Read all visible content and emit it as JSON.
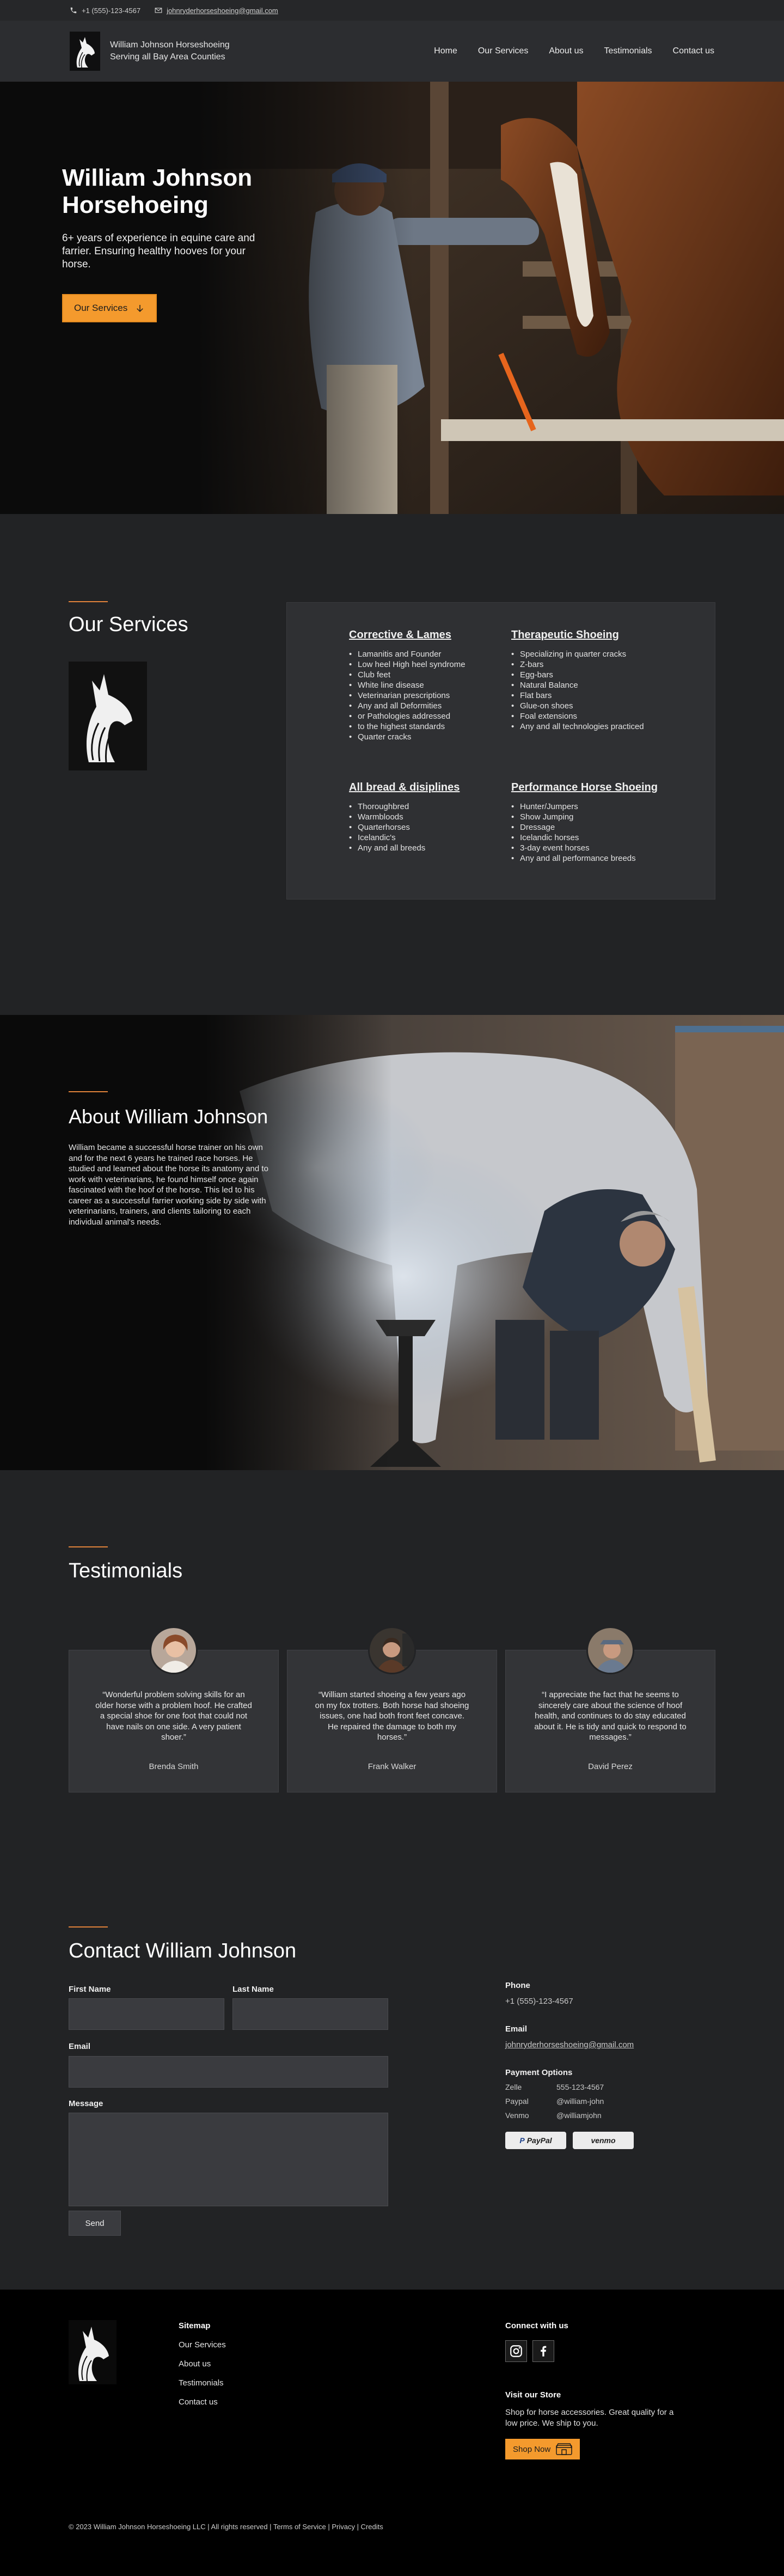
{
  "topbar": {
    "phone": "+1 (555)-123-4567",
    "email": "johnryderhorseshoeing@gmail.com"
  },
  "header": {
    "brand_line1": "William Johnson Horseshoeing",
    "brand_line2": "Serving all Bay Area Counties",
    "nav": [
      "Home",
      "Our Services",
      "About us",
      "Testimonials",
      "Contact us"
    ]
  },
  "hero": {
    "title": "William Johnson Horsehoeing",
    "subtitle": "6+ years of experience in equine care and farrier. Ensuring healthy hooves for your horse.",
    "cta": "Our Services"
  },
  "services": {
    "title": "Our Services",
    "columns": [
      {
        "heading": "Corrective & Lames",
        "items": [
          "Lamanitis and Founder",
          "Low heel High heel syndrome",
          "Club feet",
          "White line disease",
          "Veterinarian prescriptions",
          "Any and all Deformities",
          "or Pathologies addressed",
          "to the highest standards",
          "Quarter cracks"
        ]
      },
      {
        "heading": "Therapeutic Shoeing",
        "items": [
          "Specializing in quarter cracks",
          "Z-bars",
          "Egg-bars",
          "Natural Balance",
          "Flat bars",
          "Glue-on shoes",
          "Foal extensions",
          "Any and all technologies practiced"
        ]
      },
      {
        "heading": "All bread & disiplines",
        "items": [
          "Thoroughbred",
          "Warmbloods",
          "Quarterhorses",
          "Icelandic's",
          "Any and all breeds"
        ]
      },
      {
        "heading": "Performance Horse Shoeing",
        "items": [
          "Hunter/Jumpers",
          "Show Jumping",
          "Dressage",
          "Icelandic horses",
          "3-day event horses",
          "Any and all performance breeds"
        ]
      }
    ]
  },
  "about": {
    "title": "About William Johnson",
    "body": "William became a successful horse trainer on his own and for the next 6 years he trained race horses. He studied and learned about the horse its anatomy and to work with veterinarians, he found himself once again fascinated with the hoof of the horse. This led to his career as a successful farrier working side by side with veterinarians, trainers, and clients tailoring to each individual animal's needs."
  },
  "testimonials": {
    "title": "Testimonials",
    "items": [
      {
        "quote": "“Wonderful problem solving skills for an older horse with a problem hoof. He crafted a special shoe for one foot that could not have nails on one side. A very patient shoer.”",
        "name": "Brenda Smith"
      },
      {
        "quote": "“William started shoeing a few years ago on my fox trotters. Both horse had shoeing issues, one had both front feet concave. He repaired the damage to both my horses.”",
        "name": "Frank Walker"
      },
      {
        "quote": "“I appreciate the fact that he seems to sincerely care about the science of hoof health, and continues to do stay educated about it. He is tidy and quick to respond to messages.”",
        "name": "David Perez"
      }
    ]
  },
  "contact": {
    "title": "Contact William Johnson",
    "first_name": "First Name",
    "last_name": "Last Name",
    "email_label": "Email",
    "message_label": "Message",
    "send": "Send",
    "phone_label": "Phone",
    "phone": "+1 (555)-123-4567",
    "email_info_label": "Email",
    "email": "johnryderhorseshoeing@gmail.com",
    "payment_label": "Payment Options",
    "payments": [
      {
        "method": "Zelle",
        "handle": "555-123-4567"
      },
      {
        "method": "Paypal",
        "handle": "@william-john"
      },
      {
        "method": "Venmo",
        "handle": "@williamjohn"
      }
    ],
    "badge_paypal": "PayPal",
    "badge_venmo": "venmo"
  },
  "footer": {
    "sitemap_label": "Sitemap",
    "links": [
      "Our Services",
      "About us",
      "Testimonials",
      "Contact us"
    ],
    "connect_label": "Connect with us",
    "store_label": "Visit our Store",
    "store_text": "Shop for horse accessories. Great quality for a low price. We ship to you.",
    "shop_button": "Shop Now",
    "copyright": "© 2023 William Johnson Horseshoeing LLC | All rights reserved | Terms of Service | Privacy | Credits"
  },
  "colors": {
    "accent": "#f49a2d",
    "background": "#222325",
    "header": "#2c2d30",
    "card": "#333437"
  }
}
